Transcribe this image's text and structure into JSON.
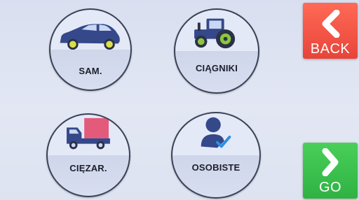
{
  "menu": {
    "items": [
      {
        "label": "SAM.",
        "icon": "car-icon"
      },
      {
        "label": "CIĄGNIKI",
        "icon": "tractor-icon"
      },
      {
        "label": "CIĘZAR.",
        "icon": "truck-icon"
      },
      {
        "label": "OSOBISTE",
        "icon": "person-check-icon"
      }
    ]
  },
  "nav": {
    "back_label": "BACK",
    "go_label": "GO"
  },
  "colors": {
    "back": "#e8443a",
    "go": "#2fb242",
    "vehicle_blue": "#34488a",
    "wheel_yellow": "#d9e04a",
    "wheel_green": "#8dc63f",
    "truck_cargo": "#e35a7a",
    "check": "#2f8fe0"
  }
}
